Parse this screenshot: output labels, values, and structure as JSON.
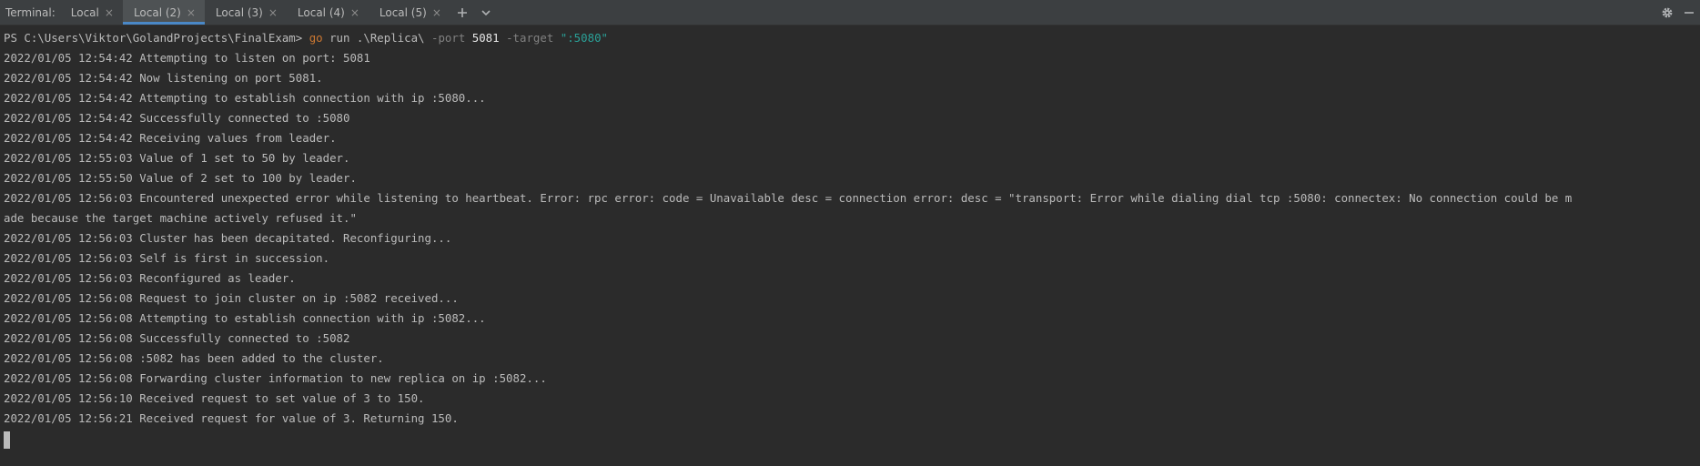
{
  "tabbar": {
    "label": "Terminal:",
    "tabs": [
      {
        "label": "Local",
        "active": false
      },
      {
        "label": "Local (2)",
        "active": true
      },
      {
        "label": "Local (3)",
        "active": false
      },
      {
        "label": "Local (4)",
        "active": false
      },
      {
        "label": "Local (5)",
        "active": false
      }
    ],
    "close_glyph": "×",
    "add_icon": "plus-icon",
    "more_icon": "chevron-down-icon",
    "settings_icon": "gear-icon",
    "hide_icon": "minimize-icon"
  },
  "terminal": {
    "prompt": {
      "path": "PS C:\\Users\\Viktor\\GolandProjects\\FinalExam> ",
      "cmd": "go",
      "args": " run .\\Replica\\ ",
      "flag_port": "-port",
      "port_value": "5081",
      "flag_target": "-target",
      "target_value": "\":5080\""
    },
    "lines": [
      "2022/01/05 12:54:42 Attempting to listen on port: 5081",
      "2022/01/05 12:54:42 Now listening on port 5081.",
      "2022/01/05 12:54:42 Attempting to establish connection with ip :5080...",
      "2022/01/05 12:54:42 Successfully connected to :5080",
      "2022/01/05 12:54:42 Receiving values from leader.",
      "2022/01/05 12:55:03 Value of 1 set to 50 by leader.",
      "2022/01/05 12:55:50 Value of 2 set to 100 by leader.",
      "2022/01/05 12:56:03 Encountered unexpected error while listening to heartbeat. Error: rpc error: code = Unavailable desc = connection error: desc = \"transport: Error while dialing dial tcp :5080: connectex: No connection could be m",
      "ade because the target machine actively refused it.\"",
      "2022/01/05 12:56:03 Cluster has been decapitated. Reconfiguring...",
      "2022/01/05 12:56:03 Self is first in succession.",
      "2022/01/05 12:56:03 Reconfigured as leader.",
      "2022/01/05 12:56:08 Request to join cluster on ip :5082 received...",
      "2022/01/05 12:56:08 Attempting to establish connection with ip :5082...",
      "2022/01/05 12:56:08 Successfully connected to :5082",
      "2022/01/05 12:56:08 :5082 has been added to the cluster.",
      "2022/01/05 12:56:08 Forwarding cluster information to new replica on ip :5082...",
      "2022/01/05 12:56:10 Received request to set value of 3 to 150.",
      "2022/01/05 12:56:21 Received request for value of 3. Returning 150."
    ]
  }
}
